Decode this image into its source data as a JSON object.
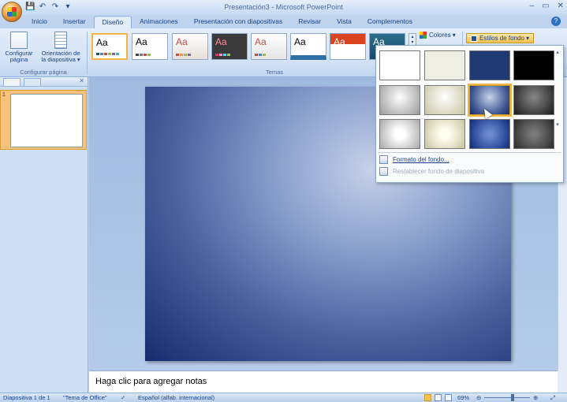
{
  "window": {
    "title": "Presentación3 - Microsoft PowerPoint",
    "minimize": "–",
    "maximize": "▭",
    "close": "✕"
  },
  "qat": {
    "save": "💾",
    "undo": "↶",
    "redo": "↷",
    "open": "▾"
  },
  "tabs": [
    "Inicio",
    "Insertar",
    "Diseño",
    "Animaciones",
    "Presentación con diapositivas",
    "Revisar",
    "Vista",
    "Complementos"
  ],
  "active_tab": "Diseño",
  "ribbon": {
    "page_setup": {
      "label": "Configurar\npágina",
      "orientation": "Orientación de\nla diapositiva ▾",
      "group": "Configurar página"
    },
    "themes_group": "Temas",
    "theme_sample": "Aa",
    "colors": "Colores ▾",
    "bg_styles": "Estilos de fondo ▾"
  },
  "gallery": {
    "swatches": [
      {
        "bg": "#ffffff"
      },
      {
        "bg": "#eeeee4"
      },
      {
        "bg": "#1f3a73"
      },
      {
        "bg": "#000000"
      },
      {
        "bg": "radial-gradient(circle at 50% 40%, #ffffff, #9a9a9a)"
      },
      {
        "bg": "radial-gradient(circle at 50% 40%, #ffffff, #c8c4a0)"
      },
      {
        "bg": "radial-gradient(circle at 50% 40%, #c6d2ea, #3b538f 70%, #1a2d62)"
      },
      {
        "bg": "radial-gradient(circle at 50% 40%, #888, #1a1a1a)"
      },
      {
        "bg": "radial-gradient(circle at 50% 50%, #ffffff 20%, #a8a8a8)"
      },
      {
        "bg": "radial-gradient(circle at 50% 50%, #fffef0 20%, #c8c4a0)"
      },
      {
        "bg": "radial-gradient(circle at 50% 50%, #6e8ad0 10%, #2b4a9a 70%, #15296a)"
      },
      {
        "bg": "radial-gradient(circle at 50% 50%, #7a7a7a 10%, #2a2a2a)"
      }
    ],
    "format_bg": "Formato del fondo...",
    "reset_bg": "Restablecer fondo de diapositiva"
  },
  "slides": {
    "number": "1"
  },
  "notes_placeholder": "Haga clic para agregar notas",
  "status": {
    "slide_info": "Diapositiva 1 de 1",
    "theme": "\"Tema de Office\"",
    "language": "Español (alfab. internacional)",
    "zoom": "69%"
  }
}
